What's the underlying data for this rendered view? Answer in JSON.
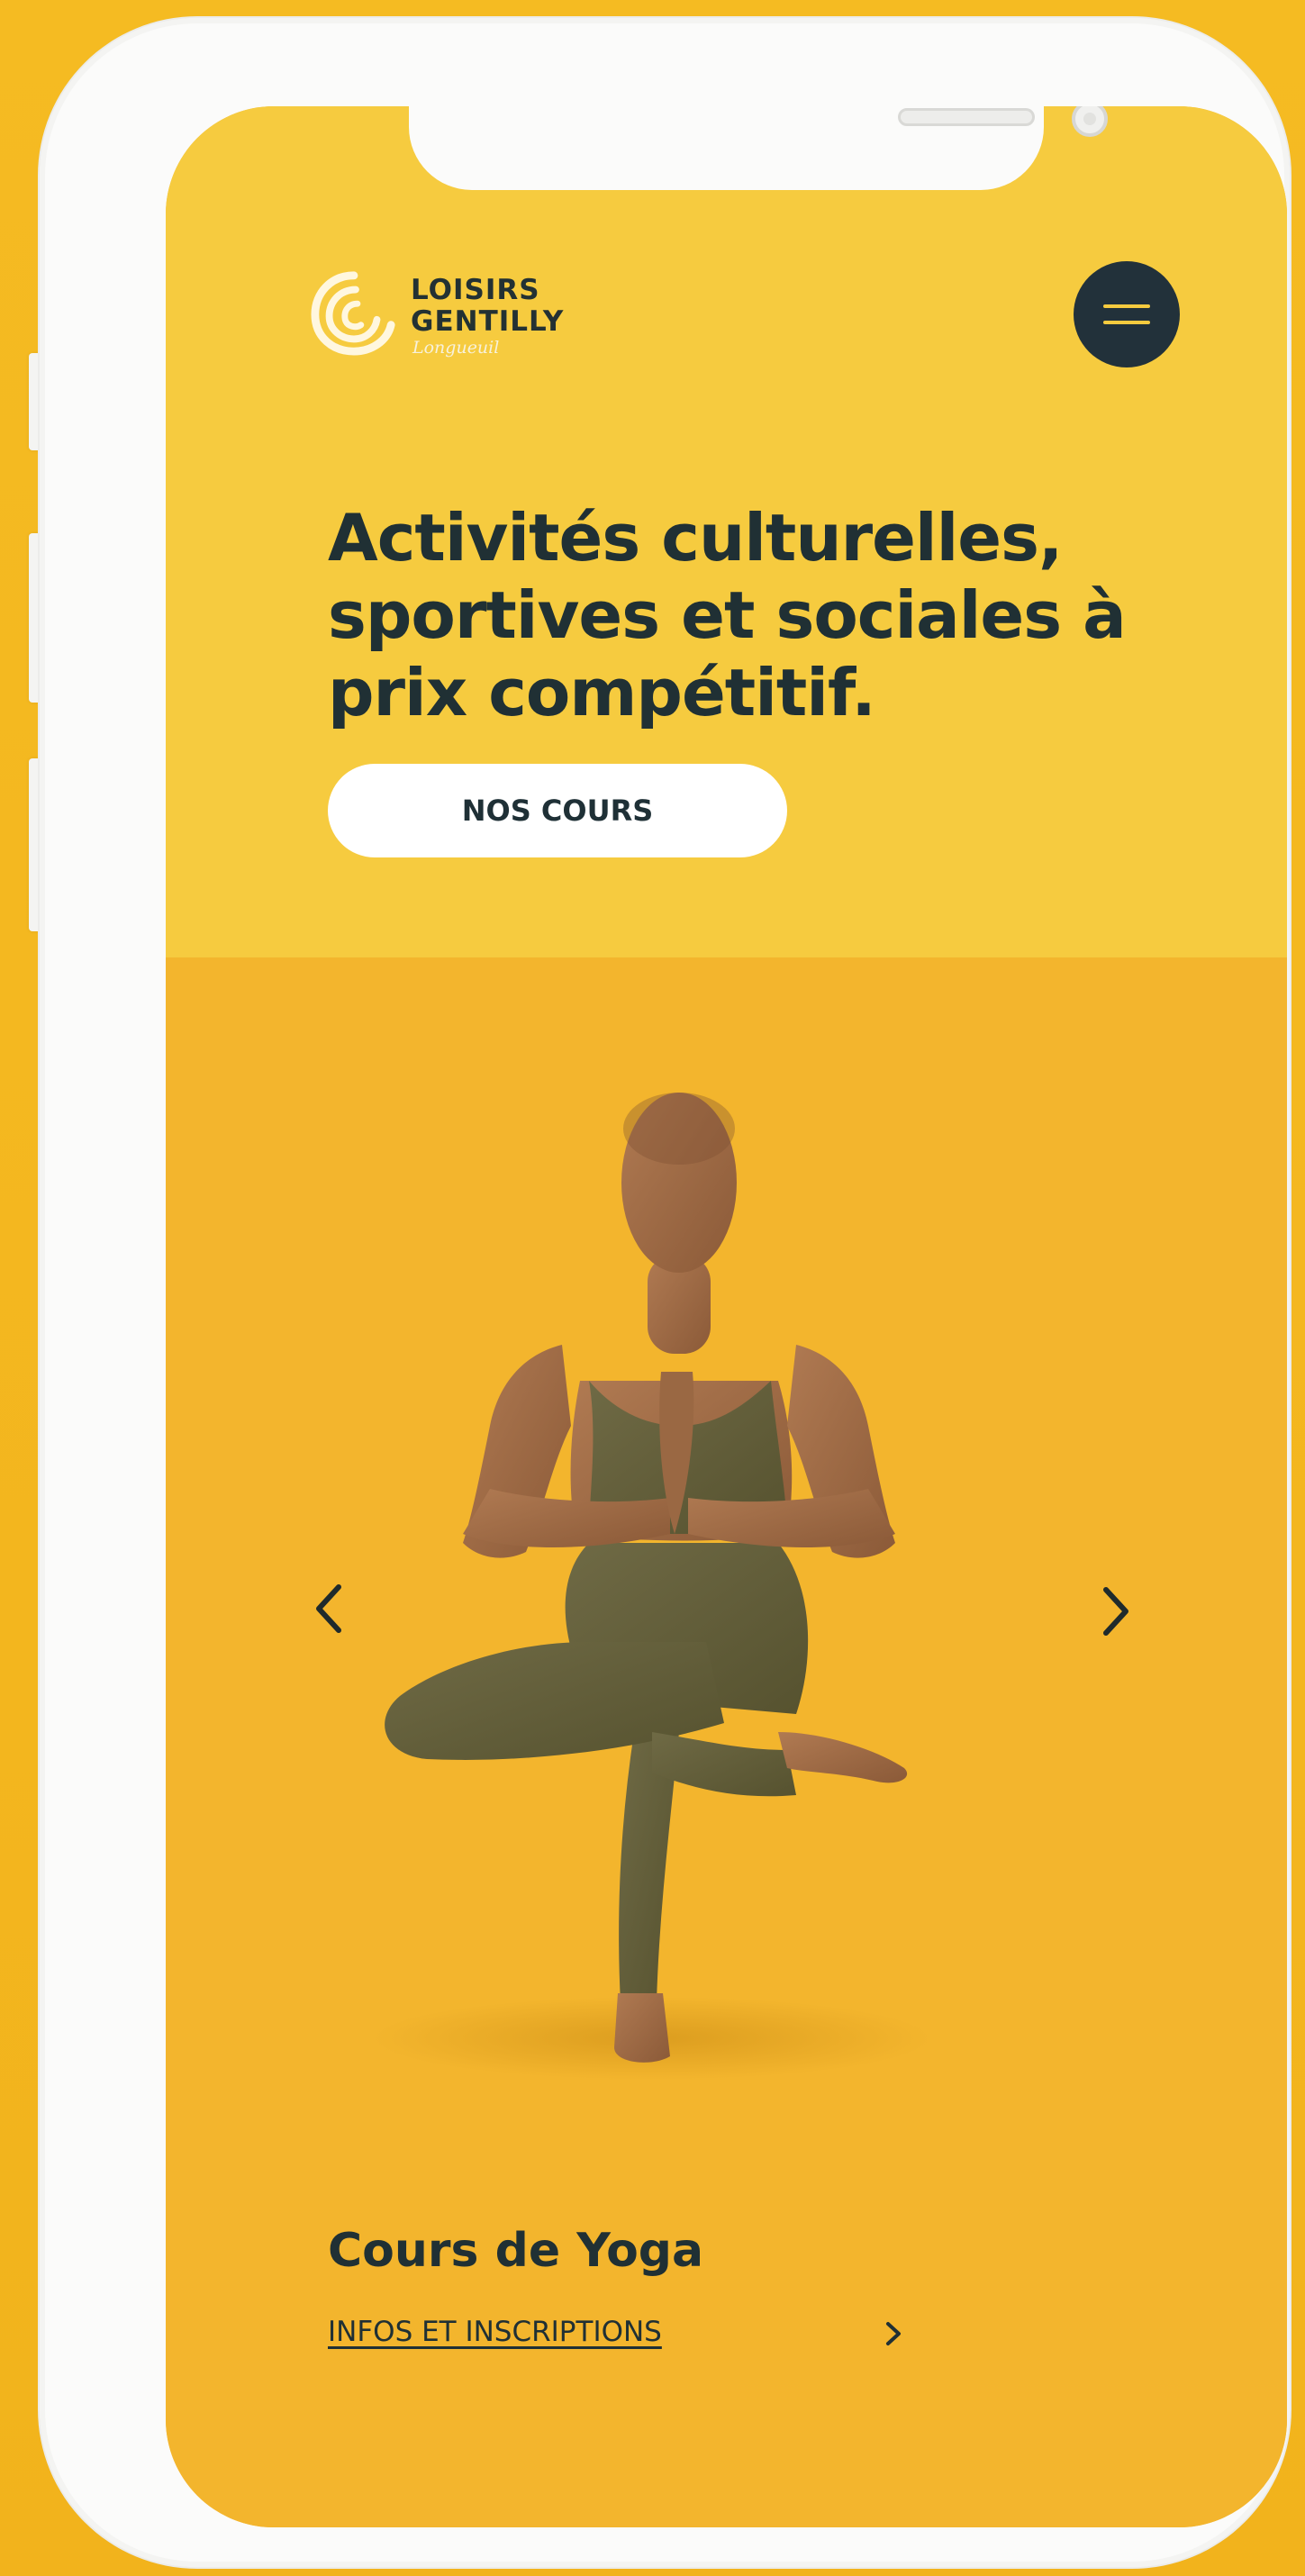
{
  "brand": {
    "name_line1": "LOISIRS",
    "name_line2": "GENTILLY",
    "tagline": "Longueuil"
  },
  "header": {
    "menu_icon": "hamburger-menu-icon"
  },
  "hero": {
    "headline": "Activités culturelles, sportives et sociales à prix compétitif.",
    "cta_label": "NOS COURS"
  },
  "slider": {
    "title": "Cours de Yoga",
    "link_label": "INFOS ET INSCRIPTIONS",
    "prev_icon": "chevron-left-icon",
    "next_icon": "chevron-right-icon",
    "link_icon": "chevron-right-icon"
  },
  "colors": {
    "hero_background": "#f6cb3f",
    "slider_background": "#f3b52d",
    "text_dark": "#203034",
    "button_dark": "#22313a",
    "button_light": "#ffffff"
  }
}
